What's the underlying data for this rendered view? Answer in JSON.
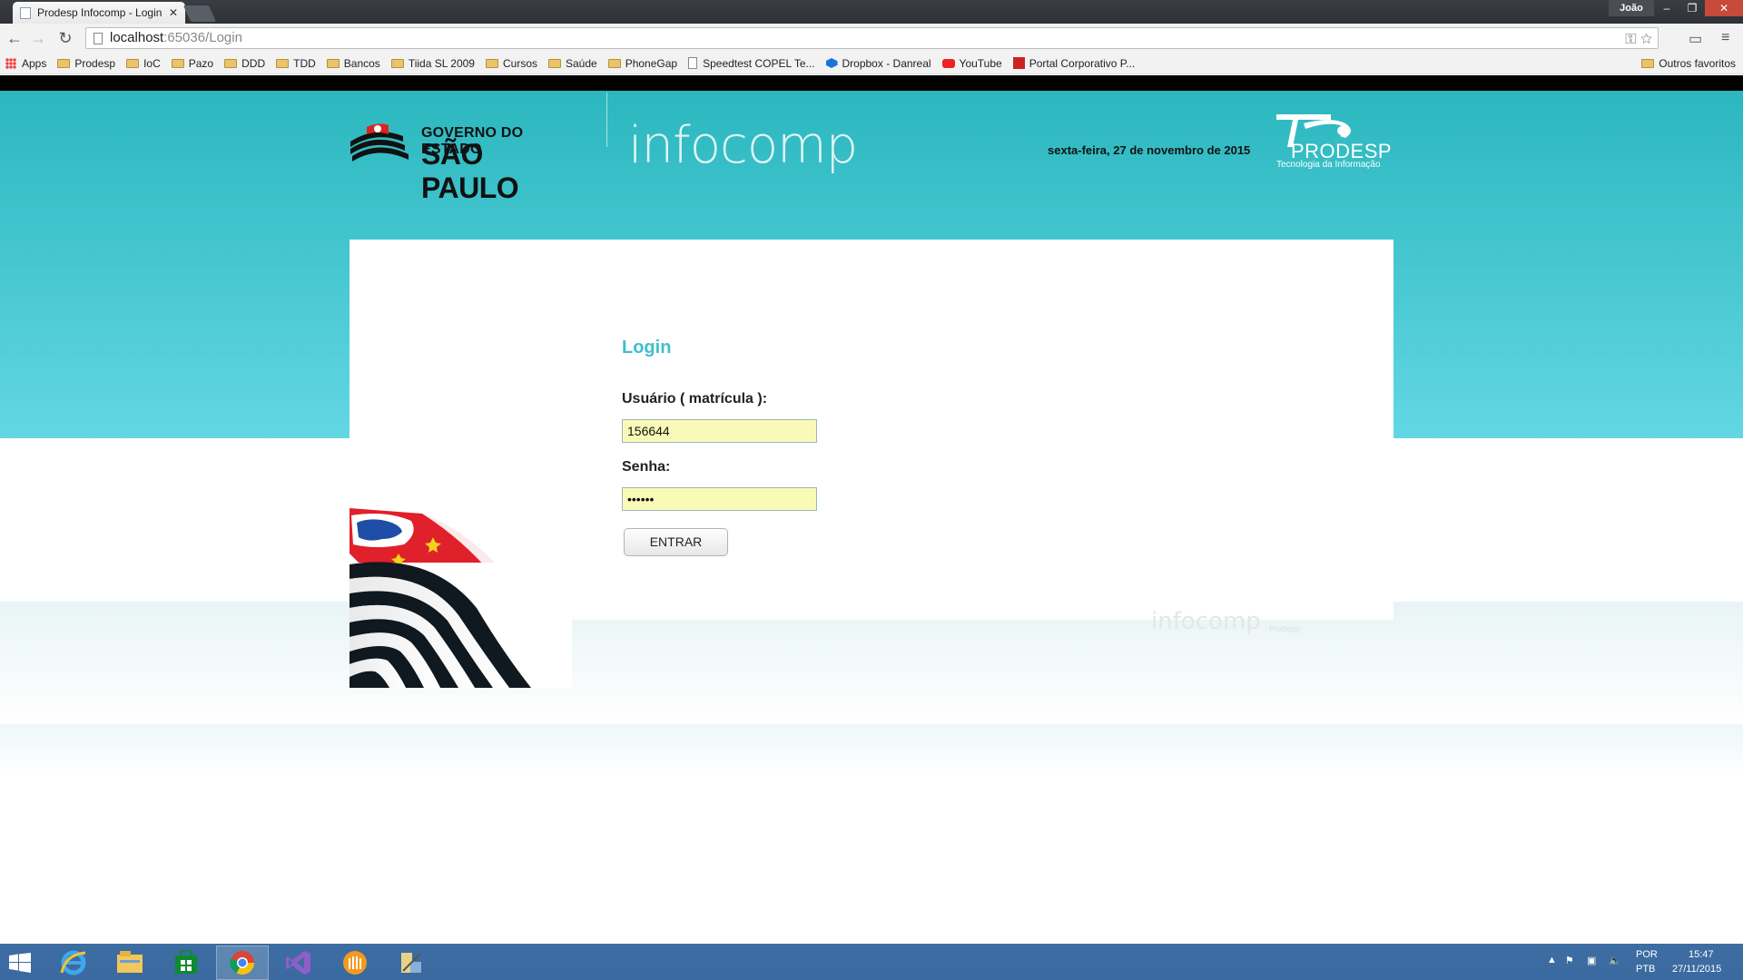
{
  "browser": {
    "tab_title": "Prodesp Infocomp - Login",
    "tab_close": "✕",
    "user_badge": "João",
    "window_controls": [
      "–",
      "❐",
      "✕"
    ],
    "url_host": "localhost",
    "url_path": ":65036/Login",
    "bookmarks": [
      {
        "label": "Apps",
        "icon": "apps-icon"
      },
      {
        "label": "Prodesp",
        "icon": "folder-icon"
      },
      {
        "label": "IoC",
        "icon": "folder-icon"
      },
      {
        "label": "Pazo",
        "icon": "folder-icon"
      },
      {
        "label": "DDD",
        "icon": "folder-icon"
      },
      {
        "label": "TDD",
        "icon": "folder-icon"
      },
      {
        "label": "Bancos",
        "icon": "folder-icon"
      },
      {
        "label": "Tiida SL 2009",
        "icon": "folder-icon"
      },
      {
        "label": "Cursos",
        "icon": "folder-icon"
      },
      {
        "label": "Saúde",
        "icon": "folder-icon"
      },
      {
        "label": "PhoneGap",
        "icon": "folder-icon"
      },
      {
        "label": "Speedtest COPEL Te...",
        "icon": "doc-icon"
      },
      {
        "label": "Dropbox - Danreal",
        "icon": "dropbox-icon"
      },
      {
        "label": "YouTube",
        "icon": "youtube-icon"
      },
      {
        "label": "Portal Corporativo P...",
        "icon": "portal-icon"
      }
    ],
    "other_bookmarks": "Outros favoritos"
  },
  "header": {
    "gov_line1": "GOVERNO DO ESTADO",
    "gov_line2": "SÃO PAULO",
    "brand": "infocomp",
    "date": "sexta-feira, 27 de novembro de 2015",
    "prodesp_name": "PRODESP",
    "prodesp_tagline": "Tecnologia da Informação"
  },
  "login": {
    "title": "Login",
    "user_label": "Usuário ( matrícula ):",
    "user_value": "156644",
    "password_label": "Senha:",
    "password_value": "••••••",
    "submit_label": "ENTRAR"
  },
  "footer": {
    "brand": "infocomp",
    "small": "Prodesp"
  },
  "taskbar": {
    "apps": [
      "start-icon",
      "internet-explorer-icon",
      "file-explorer-icon",
      "store-icon",
      "chrome-icon",
      "visual-studio-icon",
      "app-icon",
      "tools-icon"
    ],
    "lang_top": "POR",
    "lang_bottom": "PTB",
    "time": "15:47",
    "date": "27/11/2015",
    "tray_arrow": "▲"
  }
}
